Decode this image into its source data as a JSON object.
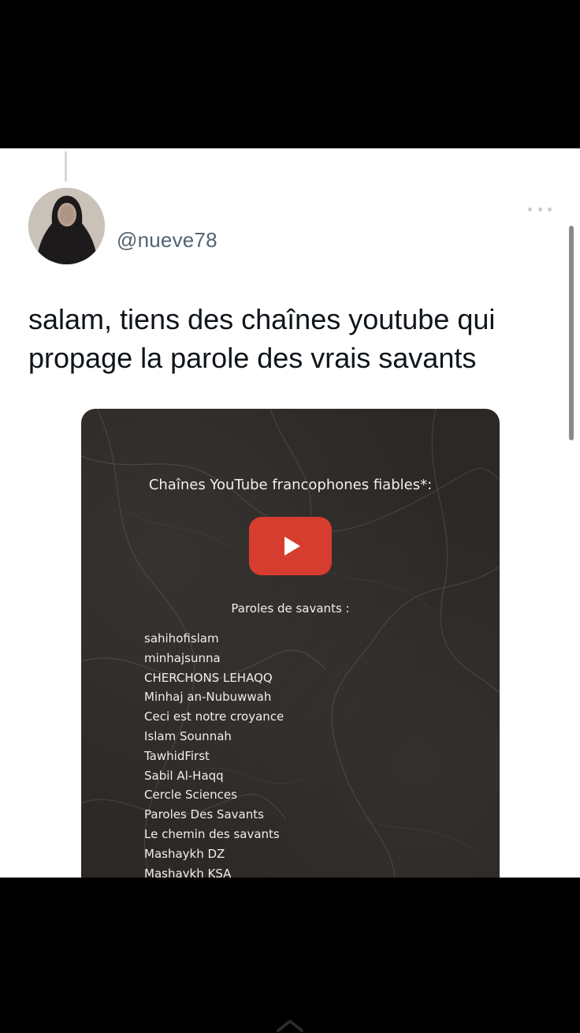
{
  "tweet": {
    "username": "@nueve78",
    "text": "salam, tiens des chaînes youtube qui propage la parole des vrais savants"
  },
  "card": {
    "title": "Chaînes YouTube francophones fiables*:",
    "subheading": "Paroles de savants :",
    "channels": [
      "sahihofislam",
      "minhajsunna",
      "CHERCHONS LEHAQQ",
      "Minhaj an-Nubuwwah",
      "Ceci est notre croyance",
      "Islam Sounnah",
      "TawhidFirst",
      "Sabil Al-Haqq",
      "Cercle Sciences",
      "Paroles Des Savants",
      "Le chemin des savants",
      "Mashaykh DZ",
      "Mashaykh KSA"
    ]
  },
  "colors": {
    "youtube_red": "#d63d2e",
    "handle_gray": "#536471",
    "text_dark": "#0f1419",
    "card_bg": "#2b2826"
  },
  "icons": [
    "more-options-icon",
    "youtube-play-icon",
    "chevron-up-icon"
  ]
}
